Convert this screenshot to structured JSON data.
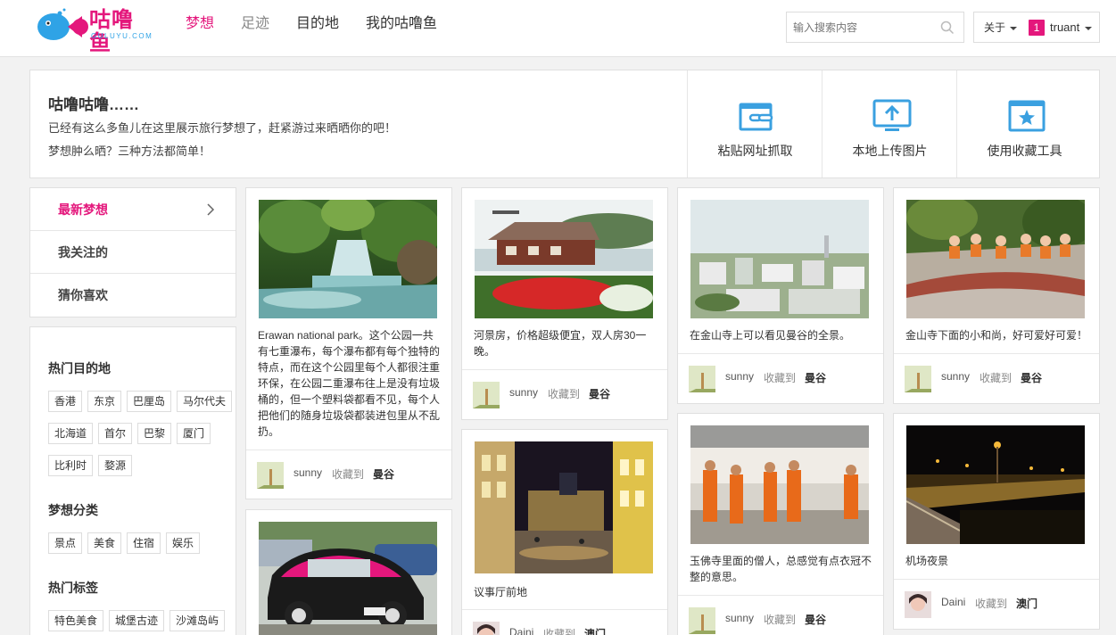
{
  "header": {
    "logo_text": "咕噜鱼",
    "logo_sub": "GULUYU.COM",
    "nav": [
      "梦想",
      "足迹",
      "目的地",
      "我的咕噜鱼"
    ],
    "search_placeholder": "输入搜索内容",
    "about": "关于",
    "badge_count": "1",
    "username": "truant"
  },
  "banner": {
    "title": "咕噜咕噜……",
    "line1": "已经有这么多鱼儿在这里展示旅行梦想了，赶紧游过来晒晒你的吧！",
    "line2": "梦想肿么晒？三种方法都简单！",
    "tools": [
      "粘贴网址抓取",
      "本地上传图片",
      "使用收藏工具"
    ]
  },
  "sidebar": {
    "menu": [
      "最新梦想",
      "我关注的",
      "猜你喜欢"
    ],
    "hot_dest_title": "热门目的地",
    "hot_dest": [
      [
        "香港",
        "东京",
        "巴厘岛",
        "马尔代夫"
      ],
      [
        "北海道",
        "首尔",
        "巴黎",
        "厦门"
      ],
      [
        "比利时",
        "婺源"
      ]
    ],
    "category_title": "梦想分类",
    "categories": [
      "景点",
      "美食",
      "住宿",
      "娱乐"
    ],
    "tags_title": "热门标签",
    "tags": [
      "特色美食",
      "城堡古迹",
      "沙滩岛屿"
    ]
  },
  "cards": {
    "fav_label": "收藏到",
    "c1": {
      "text": "Erawan national park。这个公园一共有七重瀑布，每个瀑布都有每个独特的特点，而在这个公园里每个人都很注重环保，在公园二重瀑布往上是没有垃圾桶的，但一个塑料袋都看不见，每个人把他们的随身垃圾袋都装进包里从不乱扔。",
      "user": "sunny",
      "place": "曼谷"
    },
    "c2": {
      "text": "",
      "user": "",
      "place": ""
    },
    "c3": {
      "text": "河景房，价格超级便宜，双人房30一晚。",
      "user": "sunny",
      "place": "曼谷"
    },
    "c4": {
      "text": "议事厅前地",
      "user": "Daini",
      "place": "澳门"
    },
    "c5": {
      "text": "在金山寺上可以看见曼谷的全景。",
      "user": "sunny",
      "place": "曼谷"
    },
    "c6": {
      "text": "玉佛寺里面的僧人，总感觉有点衣冠不整的意思。",
      "user": "sunny",
      "place": "曼谷"
    },
    "c7": {
      "text": "金山寺下面的小和尚，好可爱好可爱！",
      "user": "sunny",
      "place": "曼谷"
    },
    "c8": {
      "text": "机场夜景",
      "user": "Daini",
      "place": "澳门"
    }
  },
  "colors": {
    "accent": "#e4177c",
    "brand_blue": "#2fa3e6",
    "icon_blue": "#3aa0e0"
  }
}
